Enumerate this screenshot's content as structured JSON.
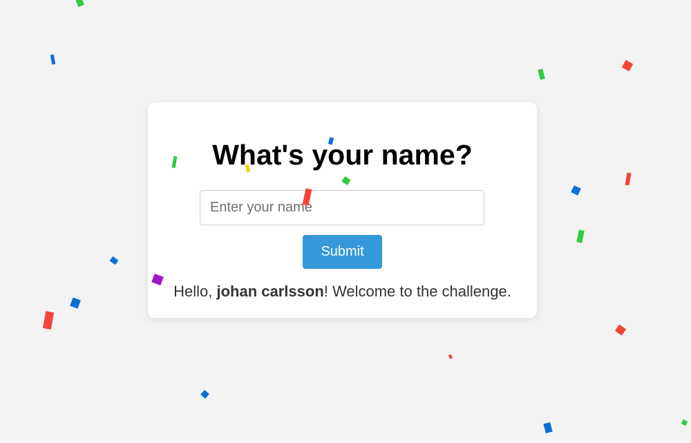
{
  "form": {
    "title": "What's your name?",
    "input_placeholder": "Enter your name",
    "input_value": "",
    "submit_label": "Submit"
  },
  "greeting": {
    "prefix": "Hello, ",
    "name": "johan carlsson",
    "suffix": "! Welcome to the challenge."
  },
  "colors": {
    "accent": "#3498db",
    "background": "#f3f3f3",
    "card": "#ffffff",
    "confetti": [
      "#2ecc40",
      "#0a6fd6",
      "#f2443a",
      "#ffd000",
      "#a516c9"
    ]
  }
}
